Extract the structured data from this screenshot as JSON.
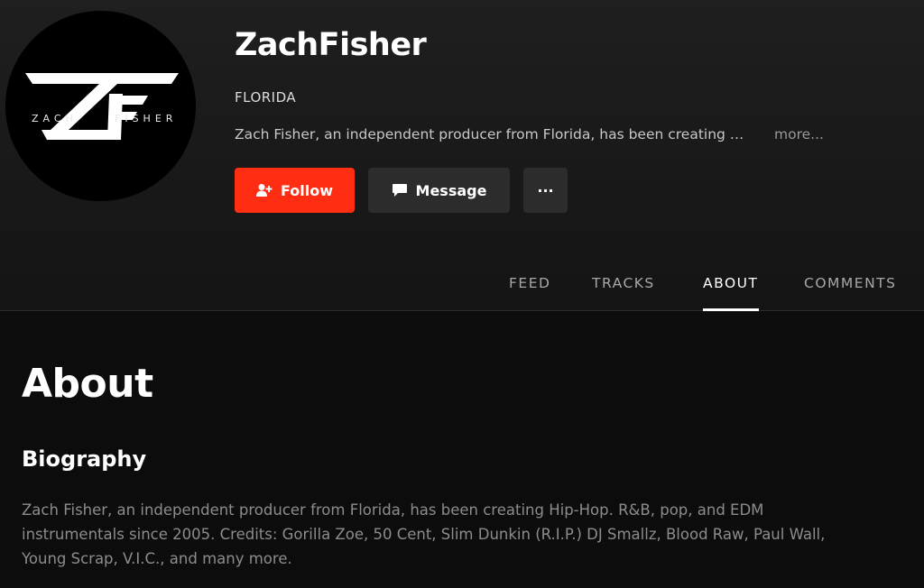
{
  "profile": {
    "logo_text_left": "ZACH",
    "logo_text_right": "FISHER",
    "name": "ZachFisher",
    "location": "FLORIDA",
    "bio_short": "Zach Fisher, an independent producer from Florida, has been creating …",
    "more_label": "more..."
  },
  "actions": {
    "follow_label": "Follow",
    "message_label": "Message",
    "more_label": "···"
  },
  "tabs": [
    {
      "label": "FEED",
      "active": false
    },
    {
      "label": "TRACKS",
      "active": false
    },
    {
      "label": "ABOUT",
      "active": true
    },
    {
      "label": "COMMENTS",
      "active": false
    }
  ],
  "about": {
    "title": "About",
    "biography_heading": "Biography",
    "biography_text": "Zach Fisher, an independent producer from Florida, has been creating Hip-Hop. R&B, pop, and EDM instrumentals since 2005. Credits: Gorilla Zoe, 50 Cent, Slim Dunkin (R.I.P.) DJ Smallz, Blood Raw, Paul Wall, Young Scrap, V.I.C., and many more."
  },
  "colors": {
    "accent": "#ff2e12",
    "background": "#0c0c0c",
    "button_dark": "#2c2c2c"
  },
  "icons": {
    "follow": "add-user-icon",
    "message": "chat-bubble-icon",
    "more": "ellipsis-icon"
  }
}
